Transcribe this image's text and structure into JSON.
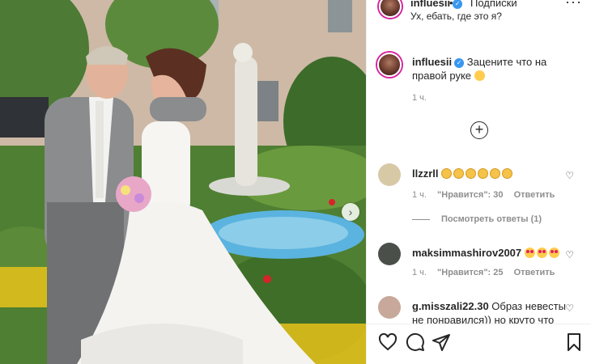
{
  "post": {
    "username": "influesii",
    "separator": "•",
    "follow_label": "Подписки",
    "header_subtitle": "Ух, ебать, где это я?",
    "caption_text": "Зацените что на правой руке",
    "caption_time": "1 ч."
  },
  "comments": [
    {
      "username": "llzzrll",
      "text": "",
      "emoji": [
        "clap",
        "clap",
        "clap",
        "clap",
        "clap",
        "clap"
      ],
      "time": "1 ч.",
      "likes": "\"Нравится\": 30",
      "reply": "Ответить",
      "view_replies": "Посмотреть ответы (1)",
      "avatar_color": "#d8c9a6"
    },
    {
      "username": "maksimmashirov2007",
      "text": "",
      "emoji": [
        "heart-eyes",
        "heart-eyes",
        "heart-eyes"
      ],
      "time": "1 ч.",
      "likes": "\"Нравится\": 25",
      "reply": "Ответить",
      "avatar_color": "#4a4f4a"
    },
    {
      "username": "g.misszali22.30",
      "text": "Образ невесты не понравился)) но круто что",
      "avatar_color": "#c7a89a"
    }
  ],
  "icons": {
    "more": "more-horizontal-icon",
    "like": "heart-icon",
    "comment": "comment-icon",
    "share": "paper-plane-icon",
    "save": "bookmark-icon",
    "load": "plus-circle-icon",
    "next": "chevron-right-icon",
    "verified": "verified-badge-icon"
  },
  "colors": {
    "verified": "#3897f0",
    "muted": "#8e8e8e",
    "text": "#262626"
  }
}
